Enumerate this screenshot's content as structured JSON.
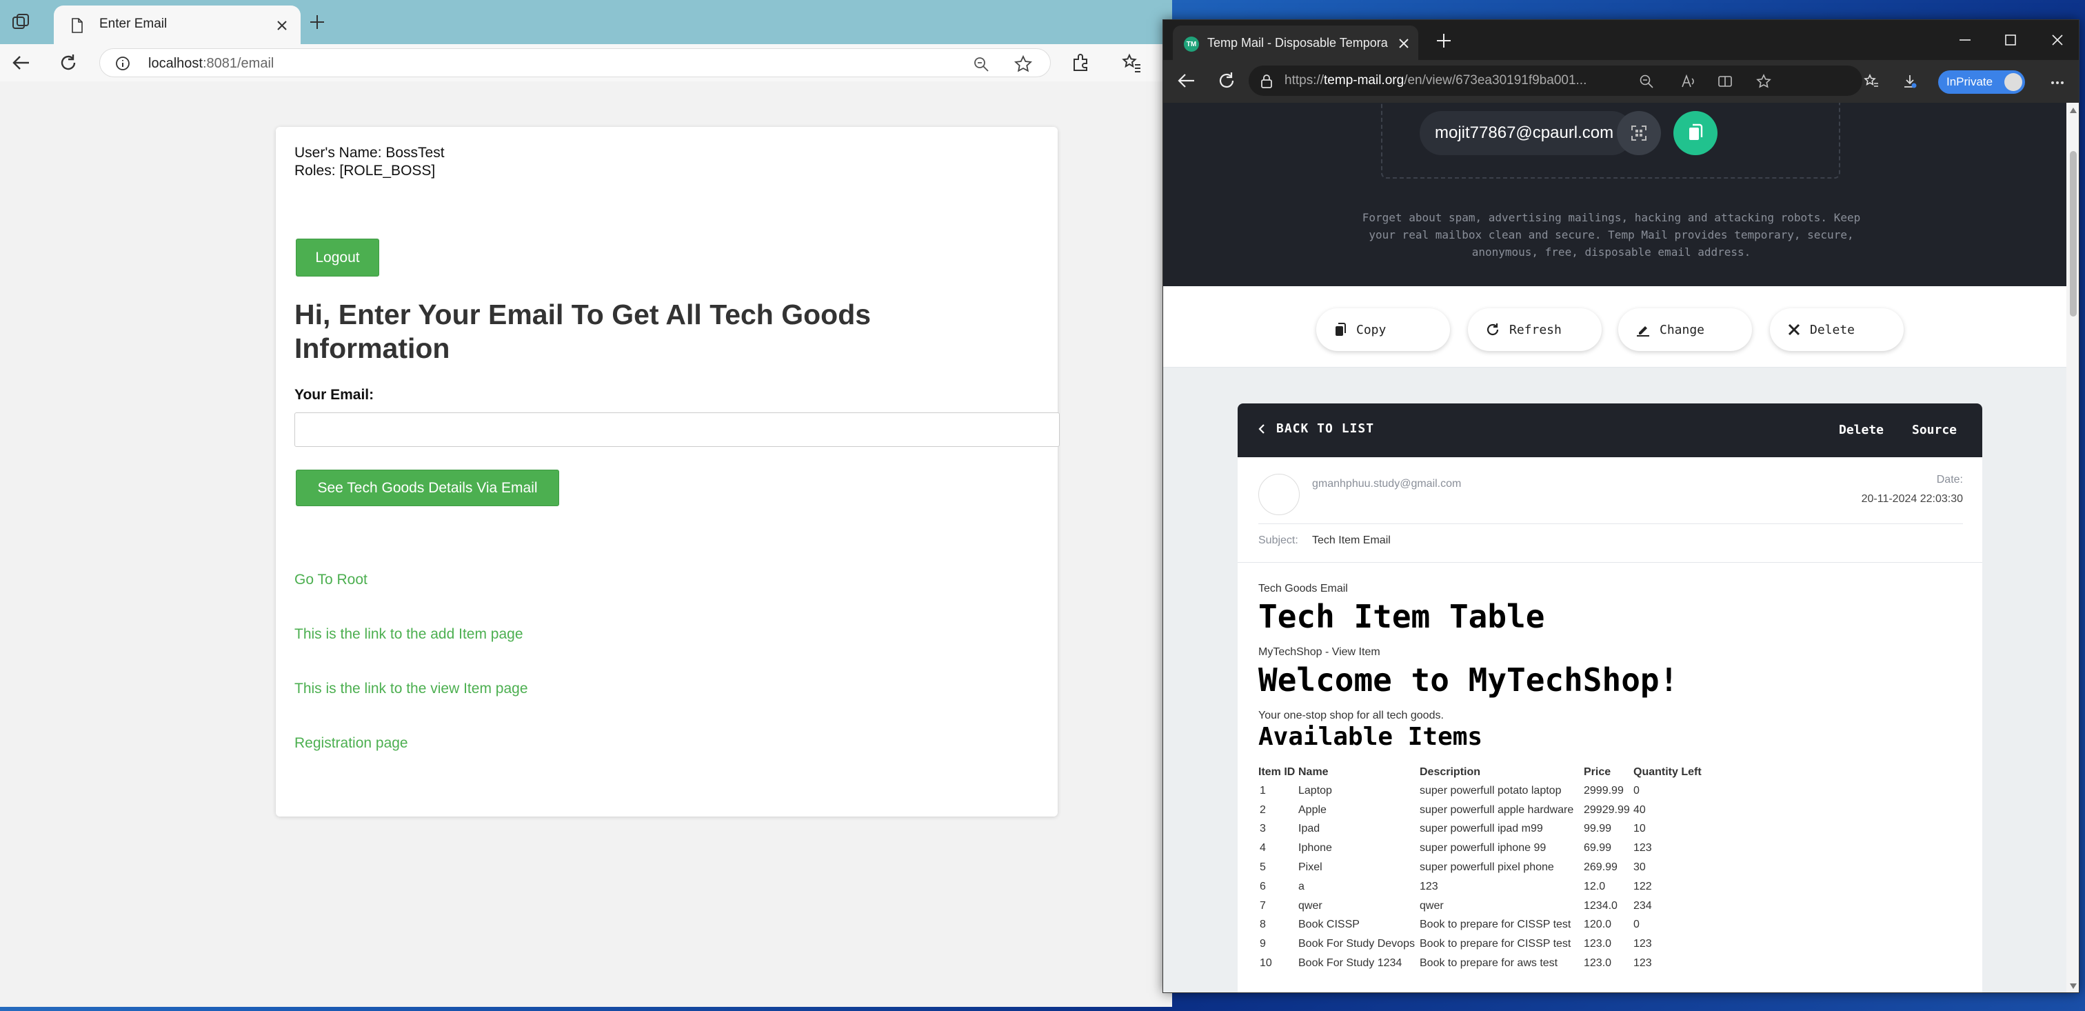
{
  "left_browser": {
    "tab_title": "Enter Email",
    "url_host": "localhost",
    "url_rest": ":8081/email"
  },
  "email_page": {
    "user_name": "User's Name: BossTest",
    "roles": "Roles: [ROLE_BOSS]",
    "logout_label": "Logout",
    "heading": "Hi, Enter Your Email To Get All Tech Goods Information",
    "email_label": "Your Email:",
    "email_value": "",
    "submit_label": "See Tech Goods Details Via Email",
    "links": {
      "root": "Go To Root",
      "add_item": "This is the link to the add Item page",
      "view_item": "This is the link to the view Item page",
      "registration": "Registration page"
    },
    "accent_color": "#4caf50"
  },
  "right_browser": {
    "tab_favicon": "TM",
    "tab_title": "Temp Mail - Disposable Temporary Email",
    "url_prefix": "https://",
    "url_host": "temp-mail.org",
    "url_path": "/en/view/673ea30191f9ba001...",
    "inprivate_label": "InPrivate"
  },
  "tempmail": {
    "address": "mojit77867@cpaurl.com",
    "hero_text": "Forget about spam, advertising mailings, hacking and attacking robots. Keep your real mailbox clean and secure. Temp Mail provides temporary, secure, anonymous, free, disposable email address.",
    "actions": {
      "copy": "Copy",
      "refresh": "Refresh",
      "change": "Change",
      "delete": "Delete"
    },
    "accent_color": "#21c28e"
  },
  "message": {
    "back_label": "BACK TO LIST",
    "delete_label": "Delete",
    "source_label": "Source",
    "sender": "gmanhphuu.study@gmail.com",
    "date_label": "Date:",
    "date_value": "20-11-2024 22:03:30",
    "subject_label": "Subject:",
    "subject_value": "Tech Item Email",
    "body": {
      "tech_goods": "Tech Goods Email",
      "table_title": "Tech Item Table",
      "shop_subtitle": "MyTechShop - View Item",
      "welcome": "Welcome to MyTechShop!",
      "tagline": "Your one-stop shop for all tech goods.",
      "available": "Available Items",
      "columns": [
        "Item ID",
        "Name",
        "Description",
        "Price",
        "Quantity Left"
      ],
      "rows": [
        [
          "1",
          "Laptop",
          "super powerfull potato laptop",
          "2999.99",
          "0"
        ],
        [
          "2",
          "Apple",
          "super powerfull apple hardware",
          "29929.99",
          "40"
        ],
        [
          "3",
          "Ipad",
          "super powerfull ipad m99",
          "99.99",
          "10"
        ],
        [
          "4",
          "Iphone",
          "super powerfull iphone 99",
          "69.99",
          "123"
        ],
        [
          "5",
          "Pixel",
          "super powerfull pixel phone",
          "269.99",
          "30"
        ],
        [
          "6",
          "a",
          "123",
          "12.0",
          "122"
        ],
        [
          "7",
          "qwer",
          "qwer",
          "1234.0",
          "234"
        ],
        [
          "8",
          "Book CISSP",
          "Book to prepare for CISSP test",
          "120.0",
          "0"
        ],
        [
          "9",
          "Book For Study Devops",
          "Book to prepare for CISSP test",
          "123.0",
          "123"
        ],
        [
          "10",
          "Book For Study 1234",
          "Book to prepare for aws test",
          "123.0",
          "123"
        ]
      ]
    }
  }
}
